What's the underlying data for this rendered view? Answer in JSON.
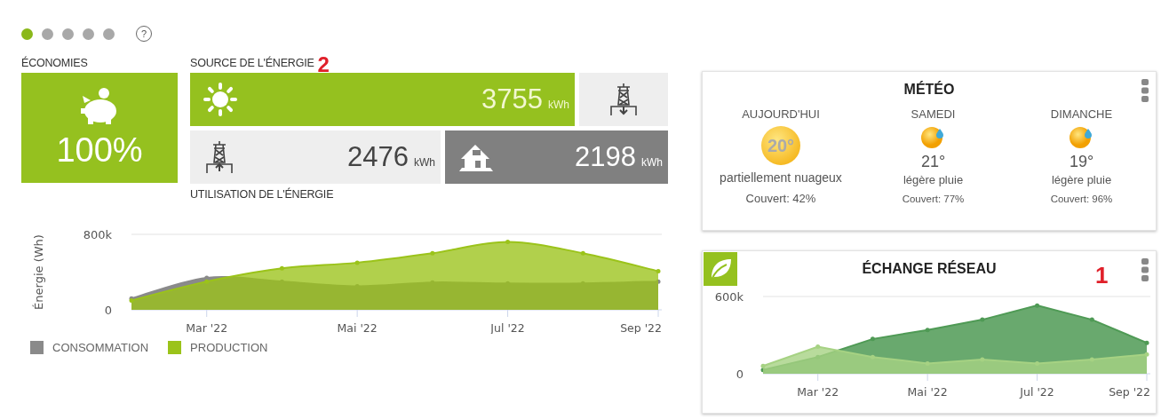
{
  "pager": {
    "dots": [
      {
        "selected": true
      },
      {
        "selected": false
      },
      {
        "selected": false
      },
      {
        "selected": false
      },
      {
        "selected": false
      }
    ],
    "help": "?"
  },
  "savings": {
    "label": "ÉCONOMIES",
    "value": "100%"
  },
  "source": {
    "label": "SOURCE DE L'ÉNERGIE",
    "annotation": "2",
    "rows": [
      [
        {
          "kind": "solar",
          "value": "3755",
          "unit": "kWh"
        },
        {
          "kind": "export"
        }
      ],
      [
        {
          "kind": "import",
          "value": "2476",
          "unit": "kWh"
        },
        {
          "kind": "home",
          "value": "2198",
          "unit": "kWh"
        }
      ]
    ]
  },
  "usage": {
    "label": "UTILISATION DE L'ÉNERGIE"
  },
  "energy_chart": {
    "chart_data": {
      "type": "area",
      "ylabel": "Énergie (Wh)",
      "categories": [
        null,
        "Mar '22",
        null,
        "Mai '22",
        null,
        "Jul '22",
        null,
        "Sep '22"
      ],
      "yticks": [
        {
          "value": 0,
          "label": "0"
        },
        {
          "value": 800000,
          "label": "800k"
        }
      ],
      "ylim": [
        0,
        800000
      ],
      "series": [
        {
          "name": "CONSOMMATION",
          "color": "#8a8a8a",
          "values": [
            120000,
            340000,
            300000,
            250000,
            290000,
            280000,
            280000,
            300000
          ]
        },
        {
          "name": "PRODUCTION",
          "color": "#9bc31a",
          "values": [
            100000,
            300000,
            440000,
            500000,
            600000,
            720000,
            600000,
            410000
          ]
        }
      ]
    }
  },
  "weather": {
    "title": "MÉTÉO",
    "days": [
      {
        "day": "AUJOURD'HUI",
        "kind": "sunny",
        "icon_text": "20°",
        "description": "partiellement nuageux",
        "cover": "Couvert: 42%"
      },
      {
        "day": "SAMEDI",
        "kind": "rain",
        "temperature": "21°",
        "description": "légère pluie",
        "cover": "Couvert: 77%"
      },
      {
        "day": "DIMANCHE",
        "kind": "rain",
        "temperature": "19°",
        "description": "légère pluie",
        "cover": "Couvert: 96%"
      }
    ]
  },
  "grid_exchange": {
    "title": "ÉCHANGE RÉSEAU",
    "annotation": "1",
    "chart_data": {
      "type": "area",
      "categories": [
        null,
        "Mar '22",
        null,
        "Mai '22",
        null,
        "Jul '22",
        null,
        "Sep '22"
      ],
      "yticks": [
        {
          "value": 0,
          "label": "0"
        },
        {
          "value": 600000,
          "label": "600k"
        }
      ],
      "ylim": [
        0,
        600000
      ],
      "series": [
        {
          "color": "#4f9a55",
          "values": [
            30000,
            130000,
            270000,
            340000,
            420000,
            530000,
            420000,
            240000
          ]
        },
        {
          "color": "#a6d283",
          "values": [
            60000,
            210000,
            130000,
            80000,
            110000,
            80000,
            110000,
            150000
          ]
        }
      ]
    }
  }
}
